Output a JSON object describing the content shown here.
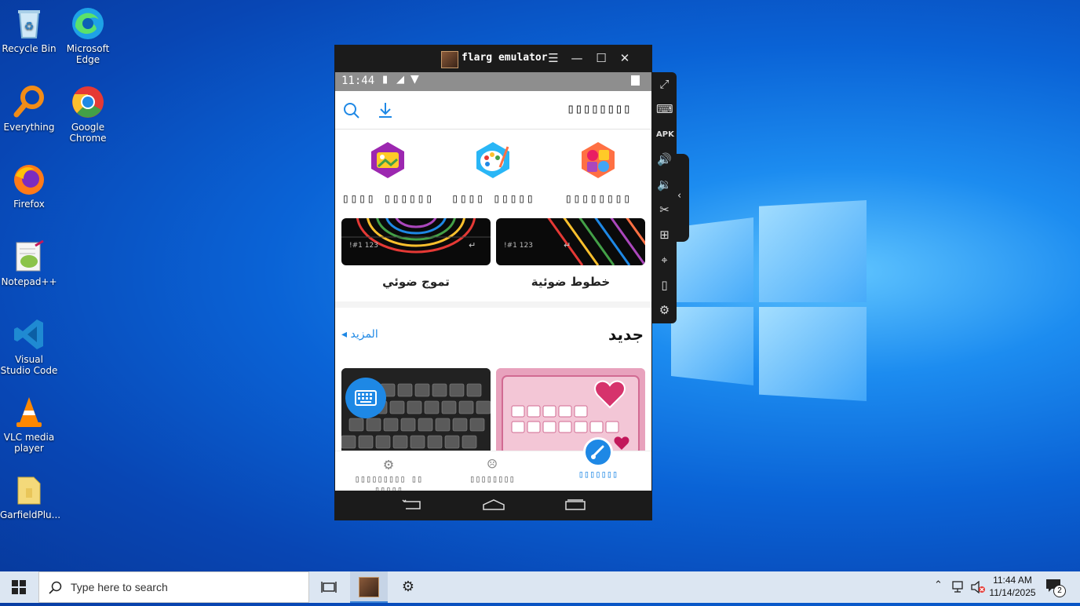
{
  "desktop": {
    "icons": [
      {
        "label": "Recycle Bin"
      },
      {
        "label": "Microsoft Edge"
      },
      {
        "label": "Everything"
      },
      {
        "label": "Google Chrome"
      },
      {
        "label": "Firefox"
      },
      {
        "label": "Notepad++"
      },
      {
        "label": "Visual Studio Code"
      },
      {
        "label": "VLC media player"
      },
      {
        "label": "GarfieldPlu..."
      }
    ]
  },
  "emulator": {
    "title": "flarg emulator",
    "controls": {
      "menu": "☰",
      "minimize": "—",
      "maximize": "☐",
      "close": "✕"
    }
  },
  "phone": {
    "status_time": "11:44",
    "header_title": "▯▯▯▯▯▯▯▯",
    "categories": [
      {
        "label": "▯▯▯▯ ▯▯▯▯▯▯"
      },
      {
        "label": "▯▯▯▯ ▯▯▯▯▯"
      },
      {
        "label": "▯▯▯▯▯▯▯▯"
      }
    ],
    "themes_top": [
      {
        "label": "تموج ضوئي",
        "keys_left": "!#1 123",
        "keys_right": "↵"
      },
      {
        "label": "خطوط ضوئية",
        "keys_left": "!#1 123",
        "keys_right": "↵"
      }
    ],
    "section_title": "جديد",
    "section_more": "المزيد",
    "nav": [
      {
        "label": "▯▯▯▯▯▯▯▯▯ ▯▯ ▯▯▯▯▯"
      },
      {
        "label": "▯▯▯▯▯▯▯▯"
      },
      {
        "label": "▯▯▯▯▯▯▯"
      }
    ]
  },
  "taskbar": {
    "search_placeholder": "Type here to search",
    "time": "11:44 AM",
    "date": "11/14/2025",
    "notification_count": "2"
  },
  "colors": {
    "accent": "#1e88e5",
    "emulator_frame": "#1b1b1b",
    "status_bar": "#8e8e8e",
    "taskbar": "#dce6f2"
  }
}
